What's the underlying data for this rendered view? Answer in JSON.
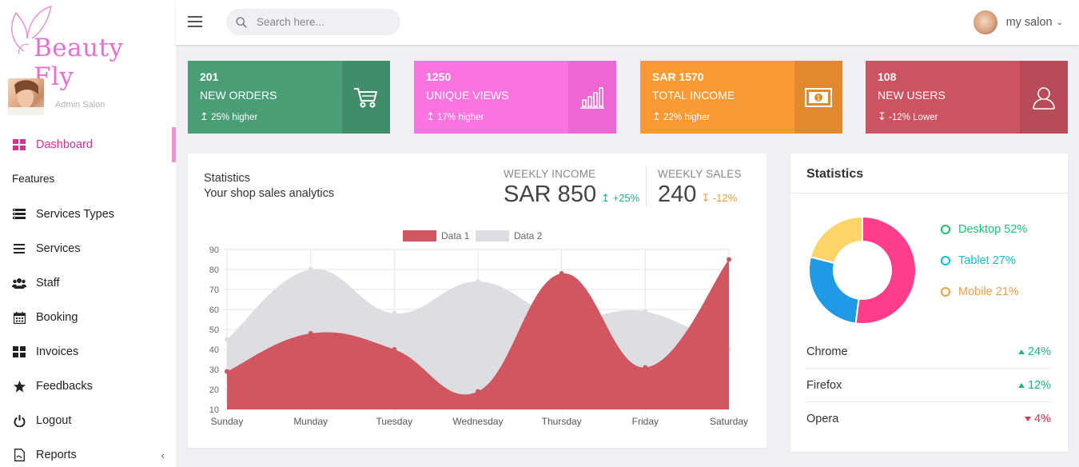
{
  "brand": {
    "name": "Beauty Fly"
  },
  "admin": {
    "name": "Admin Salon"
  },
  "sidebar": {
    "items": [
      {
        "label": "Dashboard",
        "icon": "dashboard-icon"
      },
      {
        "label": "Services Types",
        "icon": "list-icon"
      },
      {
        "label": "Services",
        "icon": "menu-lines-icon"
      },
      {
        "label": "Staff",
        "icon": "users-icon"
      },
      {
        "label": "Booking",
        "icon": "calendar-icon"
      },
      {
        "label": "Invoices",
        "icon": "grid-icon"
      },
      {
        "label": "Feedbacks",
        "icon": "star-icon"
      },
      {
        "label": "Logout",
        "icon": "power-icon"
      },
      {
        "label": "Reports",
        "icon": "file-icon"
      }
    ],
    "features_heading": "Features"
  },
  "search": {
    "placeholder": "Search here..."
  },
  "user": {
    "name": "my salon"
  },
  "cards": [
    {
      "value": "201",
      "label": "NEW ORDERS",
      "trend": "25% higher",
      "color": "#4a9e76",
      "side_color": "#418c69",
      "icon": "cart-icon"
    },
    {
      "value": "1250",
      "label": "UNIQUE VIEWS",
      "trend": "17% higher",
      "color": "#fc74e0",
      "side_color": "#ee66d2",
      "icon": "bar-chart-icon"
    },
    {
      "value": "SAR 1570",
      "label": "TOTAL INCOME",
      "trend": "22% higher",
      "color": "#f99a35",
      "side_color": "#e2892d",
      "icon": "money-icon"
    },
    {
      "value": "108",
      "label": "NEW USERS",
      "trend": "-12% Lower",
      "color": "#cc5461",
      "side_color": "#b84b58",
      "icon": "user-icon"
    }
  ],
  "statistics": {
    "title": "Statistics",
    "subtitle": "Your shop sales analytics",
    "weekly_income": {
      "label": "WEEKLY INCOME",
      "value": "SAR 850",
      "delta": "+25%"
    },
    "weekly_sales": {
      "label": "WEEKLY SALES",
      "value": "240",
      "delta": "-12%"
    }
  },
  "chart_data": {
    "type": "area",
    "categories": [
      "Sunday",
      "Munday",
      "Tuesday",
      "Wednesday",
      "Thursday",
      "Friday",
      "Saturday"
    ],
    "series": [
      {
        "name": "Data 1",
        "values": [
          29,
          48,
          40,
          19,
          78,
          31,
          85
        ],
        "color": "#d05662"
      },
      {
        "name": "Data 2",
        "values": [
          45,
          80,
          58,
          74,
          56,
          59,
          40
        ],
        "color": "#dcdee1"
      }
    ],
    "ylim": [
      10,
      90
    ],
    "yticks": [
      10,
      20,
      30,
      40,
      50,
      60,
      70,
      80,
      90
    ],
    "grid": true,
    "legend": "top"
  },
  "right_panel": {
    "title": "Statistics",
    "devices": [
      {
        "label": "Desktop 52%",
        "value": 52,
        "color": "#ff3e8b"
      },
      {
        "label": "Tablet 27%",
        "value": 27,
        "color": "#1f9be6"
      },
      {
        "label": "Mobile 21%",
        "value": 21,
        "color": "#fdd46a"
      }
    ],
    "legend_colors": [
      "#1cc274",
      "#17b9d4",
      "#f0a040"
    ],
    "browsers": [
      {
        "name": "Chrome",
        "delta": "24%",
        "dir": "up"
      },
      {
        "name": "Firefox",
        "delta": "12%",
        "dir": "up"
      },
      {
        "name": "Opera",
        "delta": "4%",
        "dir": "down"
      }
    ]
  }
}
